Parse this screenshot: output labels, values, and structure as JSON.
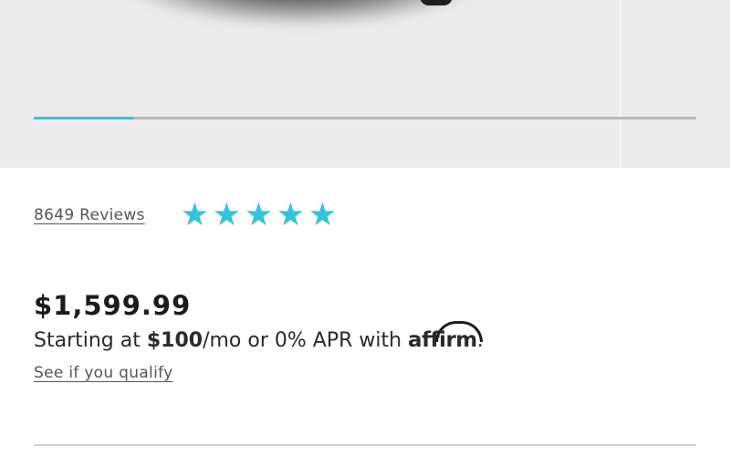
{
  "gallery": {
    "progress_fraction": 0.15
  },
  "reviews": {
    "link_text": "8649 Reviews",
    "rating_stars": 5,
    "star_color": "#35c3dc"
  },
  "pricing": {
    "price": "$1,599.99",
    "financing_prefix": "Starting at ",
    "financing_amount": "$100",
    "financing_suffix": "/mo or 0% APR with ",
    "financing_brand": "affirm",
    "financing_end": ".",
    "qualify_link": "See if you qualify"
  }
}
